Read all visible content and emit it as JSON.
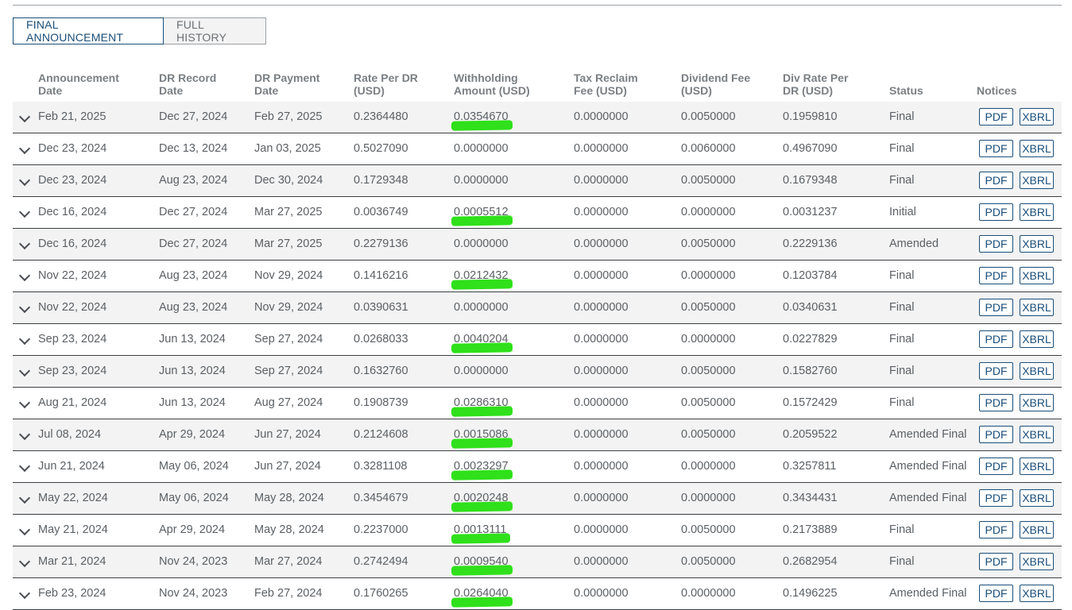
{
  "tabs": [
    {
      "label": "FINAL ANNOUNCEMENT",
      "active": true
    },
    {
      "label": "FULL HISTORY",
      "active": false
    }
  ],
  "columns": [
    "Announcement\nDate",
    "DR Record\nDate",
    "DR Payment\nDate",
    "Rate Per DR\n(USD)",
    "Withholding\nAmount (USD)",
    "Tax Reclaim\nFee (USD)",
    "Dividend Fee\n(USD)",
    "Div Rate Per\nDR (USD)",
    "Status",
    "Notices"
  ],
  "notice_labels": {
    "pdf": "PDF",
    "xbrl": "XBRL"
  },
  "highlight_color": "#2fe01a",
  "rows": [
    {
      "ann": "Feb 21, 2025",
      "rec": "Dec 27, 2024",
      "pay": "Feb 27, 2025",
      "rate": "0.2364480",
      "wh": "0.0354670",
      "tax": "0.0000000",
      "fee": "0.0050000",
      "div": "0.1959810",
      "status": "Final",
      "hl": true
    },
    {
      "ann": "Dec 23, 2024",
      "rec": "Dec 13, 2024",
      "pay": "Jan 03, 2025",
      "rate": "0.5027090",
      "wh": "0.0000000",
      "tax": "0.0000000",
      "fee": "0.0060000",
      "div": "0.4967090",
      "status": "Final",
      "hl": false
    },
    {
      "ann": "Dec 23, 2024",
      "rec": "Aug 23, 2024",
      "pay": "Dec 30, 2024",
      "rate": "0.1729348",
      "wh": "0.0000000",
      "tax": "0.0000000",
      "fee": "0.0050000",
      "div": "0.1679348",
      "status": "Final",
      "hl": false
    },
    {
      "ann": "Dec 16, 2024",
      "rec": "Dec 27, 2024",
      "pay": "Mar 27, 2025",
      "rate": "0.0036749",
      "wh": "0.0005512",
      "tax": "0.0000000",
      "fee": "0.0000000",
      "div": "0.0031237",
      "status": "Initial",
      "hl": true
    },
    {
      "ann": "Dec 16, 2024",
      "rec": "Dec 27, 2024",
      "pay": "Mar 27, 2025",
      "rate": "0.2279136",
      "wh": "0.0000000",
      "tax": "0.0000000",
      "fee": "0.0050000",
      "div": "0.2229136",
      "status": "Amended",
      "hl": false
    },
    {
      "ann": "Nov 22, 2024",
      "rec": "Aug 23, 2024",
      "pay": "Nov 29, 2024",
      "rate": "0.1416216",
      "wh": "0.0212432",
      "tax": "0.0000000",
      "fee": "0.0000000",
      "div": "0.1203784",
      "status": "Final",
      "hl": true
    },
    {
      "ann": "Nov 22, 2024",
      "rec": "Aug 23, 2024",
      "pay": "Nov 29, 2024",
      "rate": "0.0390631",
      "wh": "0.0000000",
      "tax": "0.0000000",
      "fee": "0.0050000",
      "div": "0.0340631",
      "status": "Final",
      "hl": false
    },
    {
      "ann": "Sep 23, 2024",
      "rec": "Jun 13, 2024",
      "pay": "Sep 27, 2024",
      "rate": "0.0268033",
      "wh": "0.0040204",
      "tax": "0.0000000",
      "fee": "0.0000000",
      "div": "0.0227829",
      "status": "Final",
      "hl": true
    },
    {
      "ann": "Sep 23, 2024",
      "rec": "Jun 13, 2024",
      "pay": "Sep 27, 2024",
      "rate": "0.1632760",
      "wh": "0.0000000",
      "tax": "0.0000000",
      "fee": "0.0050000",
      "div": "0.1582760",
      "status": "Final",
      "hl": false
    },
    {
      "ann": "Aug 21, 2024",
      "rec": "Jun 13, 2024",
      "pay": "Aug 27, 2024",
      "rate": "0.1908739",
      "wh": "0.0286310",
      "tax": "0.0000000",
      "fee": "0.0050000",
      "div": "0.1572429",
      "status": "Final",
      "hl": true
    },
    {
      "ann": "Jul 08, 2024",
      "rec": "Apr 29, 2024",
      "pay": "Jun 27, 2024",
      "rate": "0.2124608",
      "wh": "0.0015086",
      "tax": "0.0000000",
      "fee": "0.0050000",
      "div": "0.2059522",
      "status": "Amended Final",
      "hl": true
    },
    {
      "ann": "Jun 21, 2024",
      "rec": "May 06, 2024",
      "pay": "Jun 27, 2024",
      "rate": "0.3281108",
      "wh": "0.0023297",
      "tax": "0.0000000",
      "fee": "0.0000000",
      "div": "0.3257811",
      "status": "Amended Final",
      "hl": true
    },
    {
      "ann": "May 22, 2024",
      "rec": "May 06, 2024",
      "pay": "May 28, 2024",
      "rate": "0.3454679",
      "wh": "0.0020248",
      "tax": "0.0000000",
      "fee": "0.0000000",
      "div": "0.3434431",
      "status": "Amended Final",
      "hl": true
    },
    {
      "ann": "May 21, 2024",
      "rec": "Apr 29, 2024",
      "pay": "May 28, 2024",
      "rate": "0.2237000",
      "wh": "0.0013111",
      "tax": "0.0000000",
      "fee": "0.0050000",
      "div": "0.2173889",
      "status": "Final",
      "hl": true
    },
    {
      "ann": "Mar 21, 2024",
      "rec": "Nov 24, 2023",
      "pay": "Mar 27, 2024",
      "rate": "0.2742494",
      "wh": "0.0009540",
      "tax": "0.0000000",
      "fee": "0.0050000",
      "div": "0.2682954",
      "status": "Final",
      "hl": true
    },
    {
      "ann": "Feb 23, 2024",
      "rec": "Nov 24, 2023",
      "pay": "Feb 27, 2024",
      "rate": "0.1760265",
      "wh": "0.0264040",
      "tax": "0.0000000",
      "fee": "0.0000000",
      "div": "0.1496225",
      "status": "Amended Final",
      "hl": true
    }
  ]
}
